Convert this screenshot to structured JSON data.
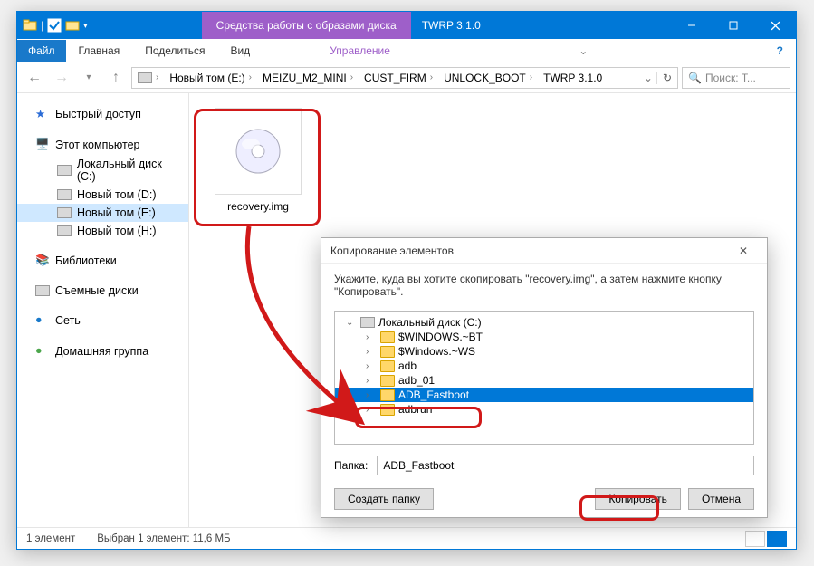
{
  "titlebar": {
    "context_label": "Средства работы с образами диска",
    "title": "TWRP 3.1.0"
  },
  "ribbon": {
    "file": "Файл",
    "tabs": [
      "Главная",
      "Поделиться",
      "Вид"
    ],
    "context_tab": "Управление"
  },
  "breadcrumbs": {
    "root": "Новый том (E:)",
    "items": [
      "MEIZU_M2_MINI",
      "CUST_FIRM",
      "UNLOCK_BOOT",
      "TWRP 3.1.0"
    ]
  },
  "search": {
    "placeholder": "Поиск: T..."
  },
  "nav": {
    "quick": "Быстрый доступ",
    "thispc": "Этот компьютер",
    "drives": [
      "Локальный диск (C:)",
      "Новый том (D:)",
      "Новый том (E:)",
      "Новый том (H:)"
    ],
    "libs": "Библиотеки",
    "removable": "Съемные диски",
    "network": "Сеть",
    "homegroup": "Домашняя группа"
  },
  "file_item": {
    "name": "recovery.img"
  },
  "statusbar": {
    "count": "1 элемент",
    "selected": "Выбран 1 элемент: 11,6 МБ"
  },
  "dialog": {
    "title": "Копирование элементов",
    "desc": "Укажите, куда вы хотите скопировать \"recovery.img\", а затем нажмите кнопку \"Копировать\".",
    "root": "Локальный диск (C:)",
    "folders": [
      "$WINDOWS.~BT",
      "$Windows.~WS",
      "adb",
      "adb_01",
      "ADB_Fastboot",
      "adbrun"
    ],
    "selected_index": 4,
    "field_label": "Папка:",
    "field_value": "ADB_Fastboot",
    "btn_newfolder": "Создать папку",
    "btn_copy": "Копировать",
    "btn_cancel": "Отмена"
  }
}
